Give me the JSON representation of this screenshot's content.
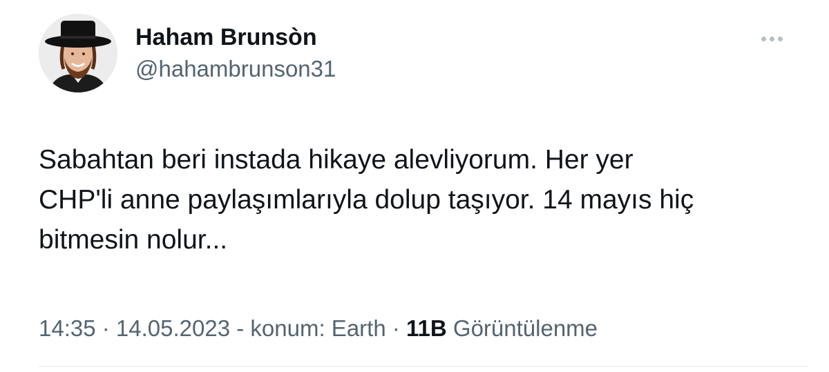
{
  "user": {
    "display_name": "Haham Brunsòn",
    "handle": "@hahambrunson31",
    "avatar_icon": "profile-photo"
  },
  "tweet": {
    "text": "Sabahtan beri instada hikaye alevliyorum. Her yer\nCHP'li anne paylaşımlarıyla dolup taşıyor. 14 mayıs hiç\nbitmesin nolur..."
  },
  "meta": {
    "time": "14:35",
    "sep1": " · ",
    "date": "14.05.2023",
    "location": " - konum: Earth",
    "sep2": " · ",
    "views_count": "11B",
    "views_label": " Görüntülenme"
  },
  "colors": {
    "primary_text": "#0f1419",
    "secondary_text": "#536471",
    "divider": "#eff3f4"
  },
  "icons": {
    "more": "more-dots-icon"
  }
}
